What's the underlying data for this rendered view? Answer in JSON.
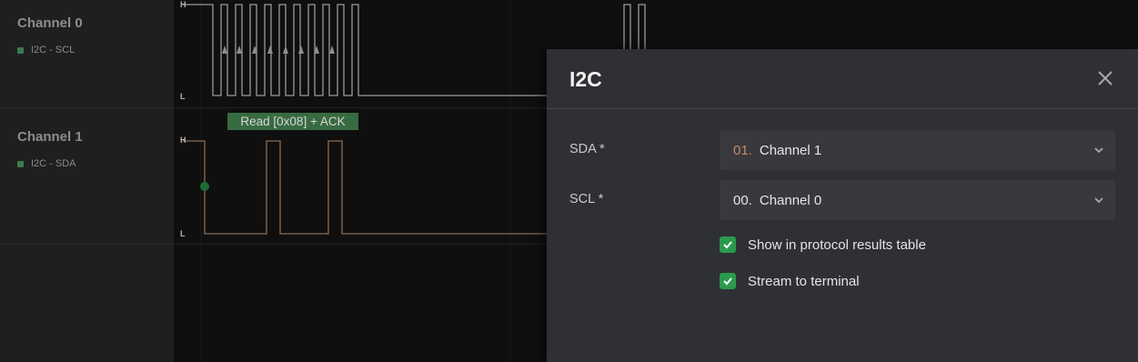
{
  "channels": [
    {
      "name": "Channel 0",
      "signal": "I2C - SCL"
    },
    {
      "name": "Channel 1",
      "signal": "I2C - SDA"
    }
  ],
  "levels": {
    "high": "H",
    "low": "L"
  },
  "decode": {
    "label": "Read [0x08] + ACK"
  },
  "panel": {
    "title": "I2C",
    "fields": [
      {
        "label": "SDA *",
        "number": "01.",
        "value": "Channel 1"
      },
      {
        "label": "SCL *",
        "number": "00.",
        "value": "Channel 0"
      }
    ],
    "options": [
      {
        "label": "Show in protocol results table",
        "checked": true
      },
      {
        "label": "Stream to terminal",
        "checked": true
      }
    ]
  },
  "colors": {
    "scl_trace": "#9a9a9a",
    "sda_trace": "#8b6c55",
    "decode_bg": "#376b41",
    "checkbox": "#2b9a4d",
    "accent_number": "#c98a5e"
  },
  "icons": [
    "close-icon",
    "chevron-down-icon",
    "checkmark-icon",
    "rising-edge-marker-icon"
  ]
}
